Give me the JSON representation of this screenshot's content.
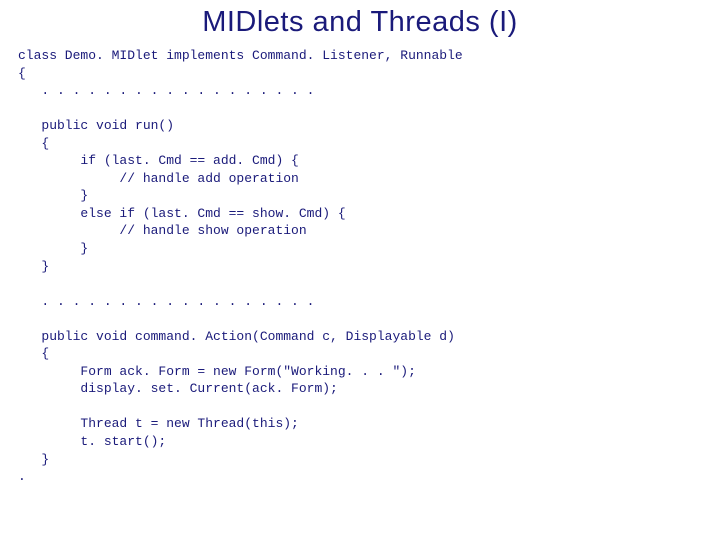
{
  "title": "MIDlets and Threads (I)",
  "code": "class Demo. MIDlet implements Command. Listener, Runnable\n{\n   . . . . . . . . . . . . . . . . . .\n\n   public void run()\n   {\n        if (last. Cmd == add. Cmd) {\n             // handle add operation\n        }\n        else if (last. Cmd == show. Cmd) {\n             // handle show operation\n        }\n   }\n\n   . . . . . . . . . . . . . . . . . .\n\n   public void command. Action(Command c, Displayable d)\n   {\n        Form ack. Form = new Form(\"Working. . . \");\n        display. set. Current(ack. Form);\n\n        Thread t = new Thread(this);\n        t. start();\n   }\n."
}
